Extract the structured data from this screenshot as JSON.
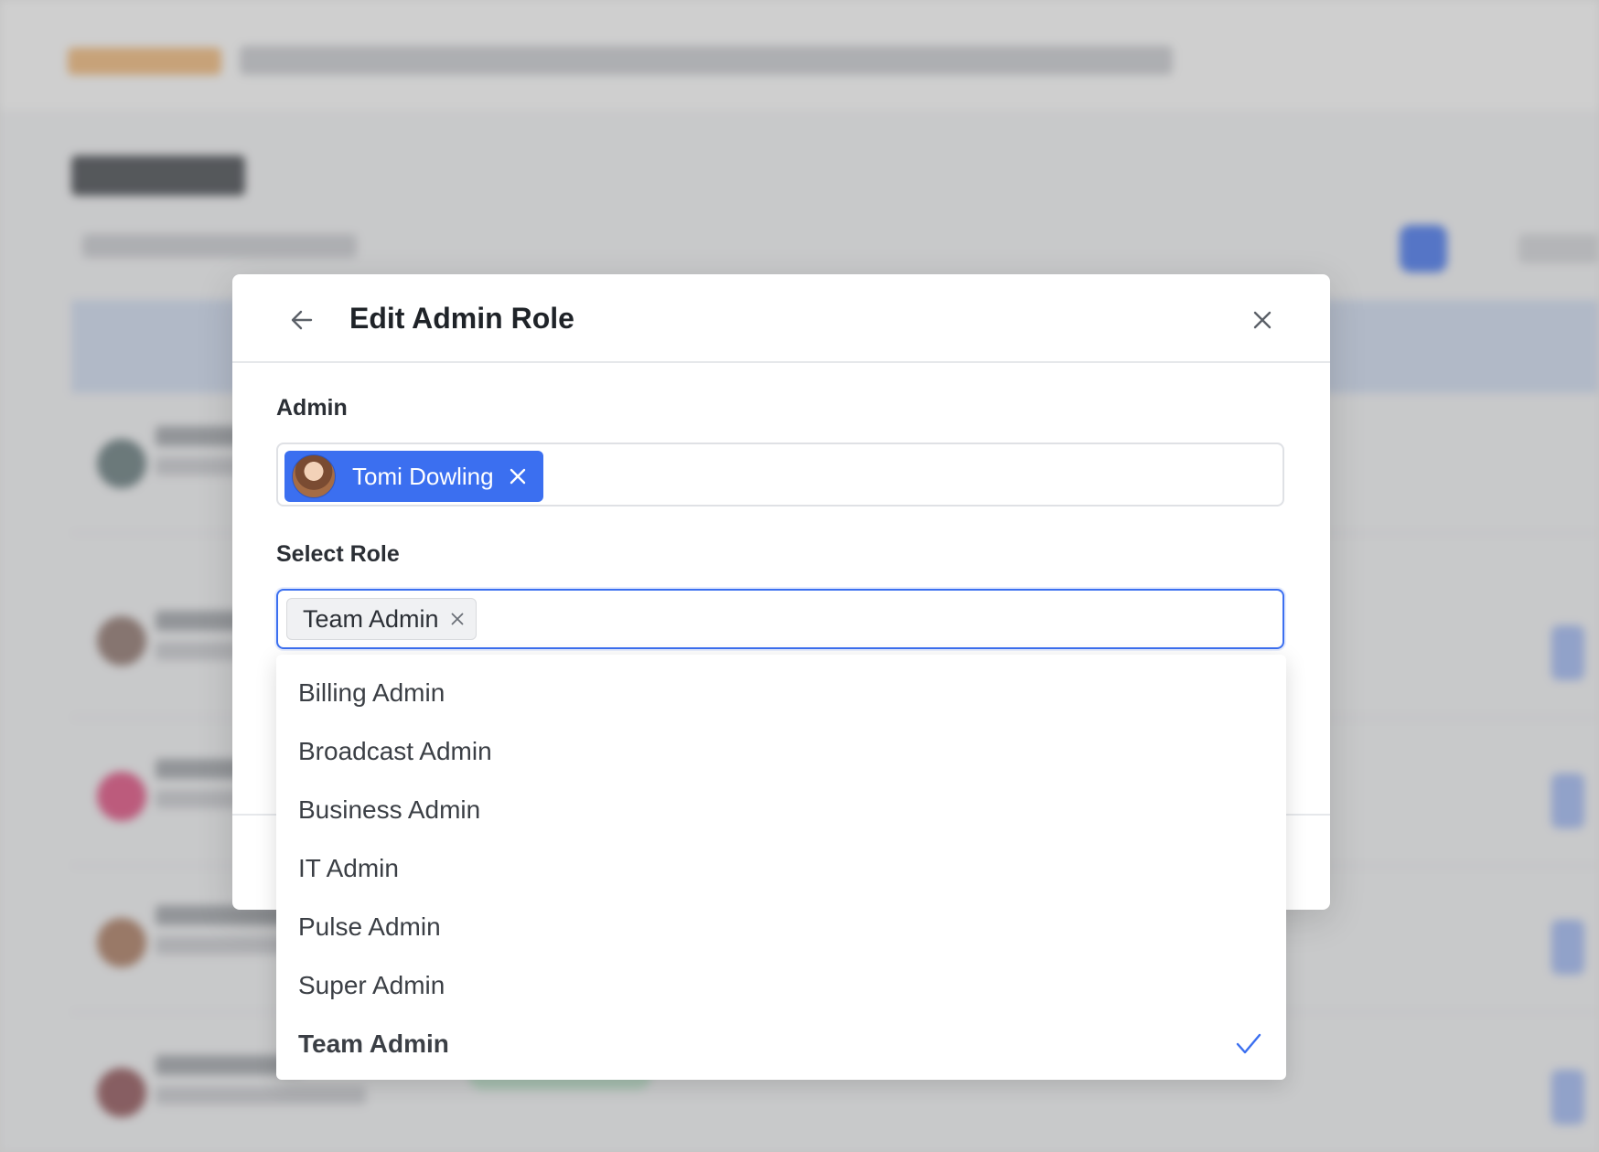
{
  "modal": {
    "title": "Edit Admin Role",
    "admin_label": "Admin",
    "admin_selected": {
      "name": "Tomi Dowling",
      "avatar_icon": "user-avatar"
    },
    "role_label": "Select Role",
    "role_selected": "Team Admin"
  },
  "dropdown": {
    "options": [
      {
        "label": "Billing Admin",
        "selected": false
      },
      {
        "label": "Broadcast Admin",
        "selected": false
      },
      {
        "label": "Business Admin",
        "selected": false
      },
      {
        "label": "IT Admin",
        "selected": false
      },
      {
        "label": "Pulse Admin",
        "selected": false
      },
      {
        "label": "Super Admin",
        "selected": false
      },
      {
        "label": "Team Admin",
        "selected": true
      }
    ]
  },
  "colors": {
    "accent": "#3b6ff0",
    "chip_text": "#ffffff",
    "check": "#3b6ff0"
  }
}
